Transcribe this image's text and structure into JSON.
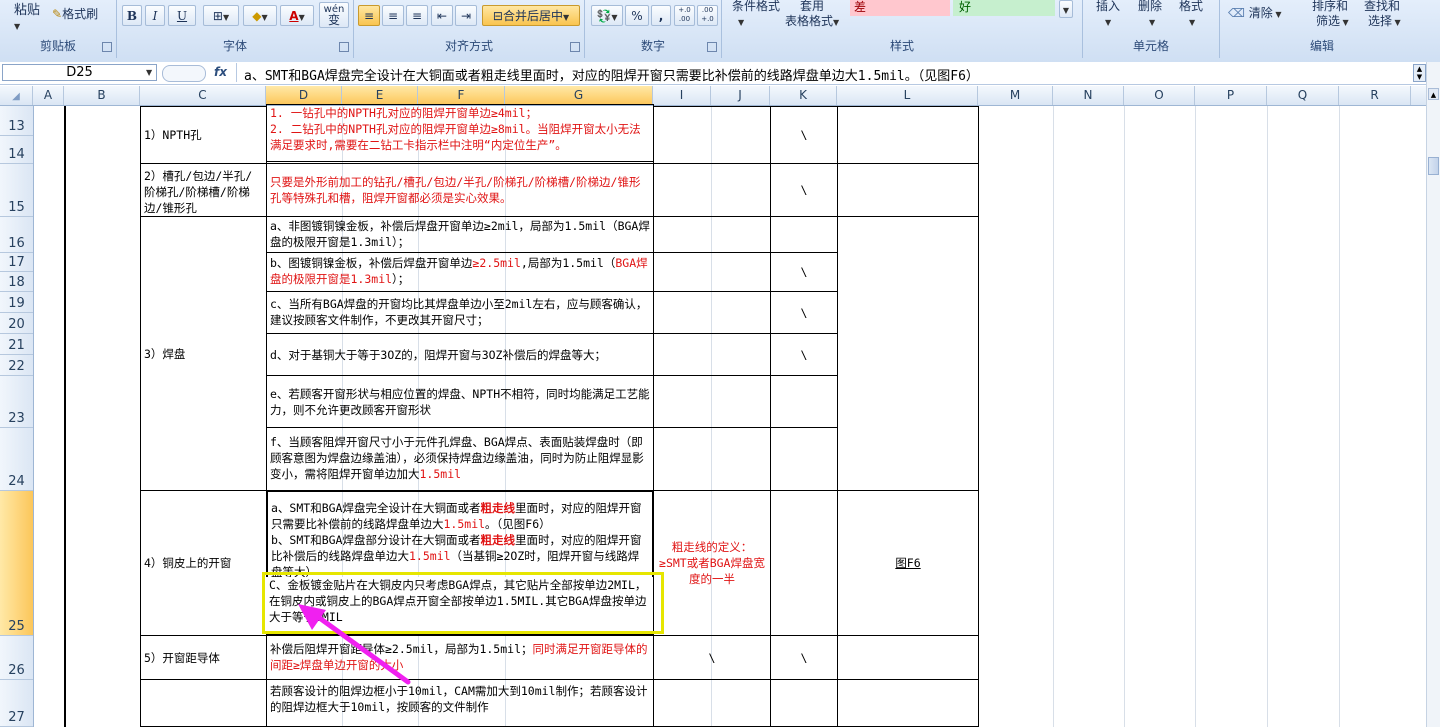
{
  "ribbon": {
    "paste": "粘贴",
    "format_painter": "格式刷",
    "clipboard_group": "剪贴板",
    "font_group": "字体",
    "bold": "B",
    "italic": "I",
    "underline": "U",
    "font_color_letter": "A",
    "wen": "wén",
    "wen_char": "变",
    "align_group": "对齐方式",
    "merge_center": "合并后居中",
    "number_group": "数字",
    "percent": "%",
    "comma": ",",
    "dec_inc": "+.0 .00",
    "dec_dec": ".00 +.0",
    "cond_format": "条件格式",
    "apply": "套用",
    "table_format": "表格格式",
    "style_bad": "差",
    "style_good": "好",
    "style_group": "样式",
    "insert": "插入",
    "delete": "删除",
    "format": "格式",
    "cells_group": "单元格",
    "clear": "清除",
    "sort_filter_1": "排序和",
    "sort_filter_2": "筛选",
    "find_select_1": "查找和",
    "find_select_2": "选择",
    "edit_group": "编辑",
    "colors": {
      "bad": "#ffc7ce",
      "good": "#c6efce"
    }
  },
  "formula_bar": {
    "name_box": "D25",
    "fx": "fx",
    "content": "a、SMT和BGA焊盘完全设计在大铜面或者粗走线里面时，对应的阻焊开窗只需要比补偿前的线路焊盘单边大1.5mil。（见图F6）"
  },
  "columns": [
    "A",
    "B",
    "C",
    "D",
    "E",
    "F",
    "G",
    "I",
    "J",
    "K",
    "L",
    "M",
    "N",
    "O",
    "P",
    "Q",
    "R"
  ],
  "selected_columns": [
    "D",
    "E",
    "F",
    "G"
  ],
  "rows": [
    "13",
    "14",
    "15",
    "16",
    "17",
    "18",
    "19",
    "20",
    "21",
    "22",
    "23",
    "24",
    "25",
    "26",
    "27"
  ],
  "selected_row": "25",
  "table": {
    "r1": {
      "label": "1）NPTH孔",
      "line1": "1. 一钻孔中的NPTH孔对应的阻焊开窗单边≥4mil；",
      "line2": "2. 二钻孔中的NPTH孔对应的阻焊开窗单边≥8mil。当阻焊开窗太小无法满足要求时,需要在二钻工卡指示栏中注明“内定位生产”。",
      "k": "\\"
    },
    "r2": {
      "label": "2）槽孔/包边/半孔/阶梯孔/阶梯槽/阶梯边/锥形孔",
      "text": "只要是外形前加工的钻孔/槽孔/包边/半孔/阶梯孔/阶梯槽/阶梯边/锥形孔等特殊孔和槽，阻焊开窗都必须是实心效果。",
      "k": "\\"
    },
    "pad": {
      "label": "3）焊盘",
      "a": "a、非图镀铜镍金板，补偿后焊盘开窗单边≥2mil，局部为1.5mil（BGA焊盘的极限开窗是1.3mil）；",
      "b1": "b、图镀铜镍金板，补偿后焊盘开窗单边",
      "b2": "≥2.5mil",
      "b3": ",局部为1.5mil（",
      "b4": "BGA焊盘的极限开窗是1.3mil",
      "b5": "）；",
      "c": "c、当所有BGA焊盘的开窗均比其焊盘单边小至2mil左右，应与顾客确认，建议按顾客文件制作，不更改其开窗尺寸；",
      "d": "d、对于基铜大于等于3OZ的，阻焊开窗与3OZ补偿后的焊盘等大；",
      "e": "e、若顾客开窗形状与相应位置的焊盘、NPTH不相符，同时均能满足工艺能力，则不允许更改顾客开窗形状",
      "f1": "f、当顾客阻焊开窗尺寸小于元件孔焊盘、BGA焊点、表面贴装焊盘时（即顾客意图为焊盘边缘盖油），必须保持焊盘边缘盖油，同时为防止阻焊显影变小，需将阻焊开窗单边加大",
      "f2": "1.5mil",
      "k": "\\"
    },
    "copper": {
      "label": "4）铜皮上的开窗",
      "a1": "a、SMT和BGA焊盘完全设计在大铜面或者",
      "a2": "粗走线",
      "a3": "里面时，对应的阻焊开窗只需要比补偿前的线路焊盘单边大",
      "a4": "1.5mil",
      "a5": "。（见图F6）",
      "b1": "b、SMT和BGA焊盘部分设计在大铜面或者",
      "b2": "粗走线",
      "b3": "里面时，对应的阻焊开窗比补偿后的线路焊盘单边大",
      "b4": "1.5mil",
      "b5": "（当基铜≥2OZ时，阻焊开窗与线路焊盘等大）",
      "c": "C、金板镀金贴片在大铜皮内只考虑BGA焊点，其它贴片全部按单边2MIL，在铜皮内或铜皮上的BGA焊点开窗全部按单边1.5MIL.其它BGA焊盘按单边大于等于2MIL",
      "note": "粗走线的定义：≥SMT或者BGA焊盘宽度的一半",
      "fig": "图F6"
    },
    "gap": {
      "label": "5）开窗距导体",
      "t1": "补偿后阻焊开窗距导体≥2.5mil，局部为1.5mil；",
      "t2": "同时满足开窗距导体的间距≥焊盘单边开窗的大小",
      "i": "\\",
      "k": "\\"
    },
    "frame": {
      "text": "若顾客设计的阻焊边框小于10mil，CAM需加大到10mil制作；若顾客设计的阻焊边框大于10mil，按顾客的文件制作"
    }
  }
}
